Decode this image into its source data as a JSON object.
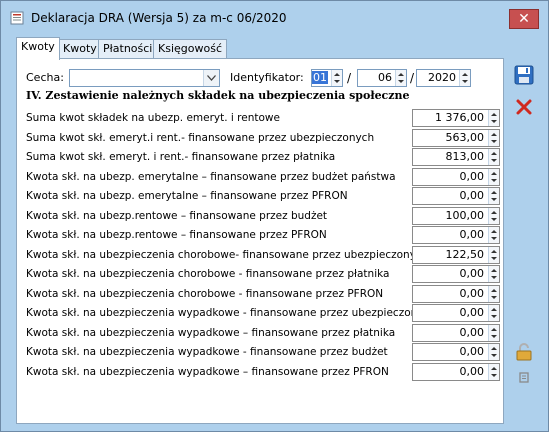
{
  "window": {
    "title": "Deklaracja DRA (Wersja 5) za m-c 06/2020",
    "close_label": "✕"
  },
  "tabs": [
    {
      "label": "Kwoty",
      "active": true
    },
    {
      "label": "Kwoty",
      "active": false
    },
    {
      "label": "Płatności",
      "active": false
    },
    {
      "label": "Księgowość",
      "active": false
    }
  ],
  "form": {
    "cecha_label": "Cecha:",
    "cecha_value": "",
    "identyfikator_label": "Identyfikator:",
    "id_part1": "01",
    "id_part2": "06",
    "id_part3": "2020",
    "slash": "/"
  },
  "section_title": "IV. Zestawienie należnych składek  na ubezpieczenia społeczne",
  "rows": [
    {
      "label": "Suma kwot składek na ubezp. emeryt. i rentowe",
      "value": "1 376,00"
    },
    {
      "label": "Suma kwot skł. emeryt.i rent.- finansowane przez ubezpieczonych",
      "value": "563,00"
    },
    {
      "label": "Suma kwot skł. emeryt. i rent.- finansowane przez płatnika",
      "value": "813,00"
    },
    {
      "label": "Kwota skł. na ubezp. emerytalne – finansowane przez budżet państwa",
      "value": "0,00"
    },
    {
      "label": "Kwota skł. na ubezp. emerytalne – finansowane przez PFRON",
      "value": "0,00"
    },
    {
      "label": "Kwota skł. na ubezp.rentowe – finansowane przez budżet",
      "value": "100,00"
    },
    {
      "label": "Kwota skł. na ubezp.rentowe – finansowane przez PFRON",
      "value": "0,00"
    },
    {
      "label": "Kwota skł. na ubezpieczenia chorobowe- finansowane przez ubezpieczonych",
      "value": "122,50"
    },
    {
      "label": "Kwota skł. na ubezpieczenia chorobowe - finansowane przez płatnika",
      "value": "0,00"
    },
    {
      "label": "Kwota skł. na ubezpieczenia chorobowe - finansowane przez PFRON",
      "value": "0,00"
    },
    {
      "label": "Kwota skł. na ubezpieczenia wypadkowe - finansowane przez ubezpieczonych",
      "value": "0,00"
    },
    {
      "label": "Kwota skł. na ubezpieczenia wypadkowe – finansowane przez płatnika",
      "value": "0,00"
    },
    {
      "label": "Kwota skł. na ubezpieczenia wypadkowe - finansowane przez budżet",
      "value": "0,00"
    },
    {
      "label": "Kwota skł. na ubezpieczenia wypadkowe – finansowane przez PFRON",
      "value": "0,00"
    }
  ],
  "sidebar": {
    "save_icon": "floppy-disk-icon",
    "cancel_icon": "red-x-icon",
    "lock_icon": "padlock-icon",
    "pin_icon": "pin-icon"
  },
  "colors": {
    "window_bg": "#aed0ec",
    "close_bg": "#c75050",
    "selection": "#3875d7"
  }
}
